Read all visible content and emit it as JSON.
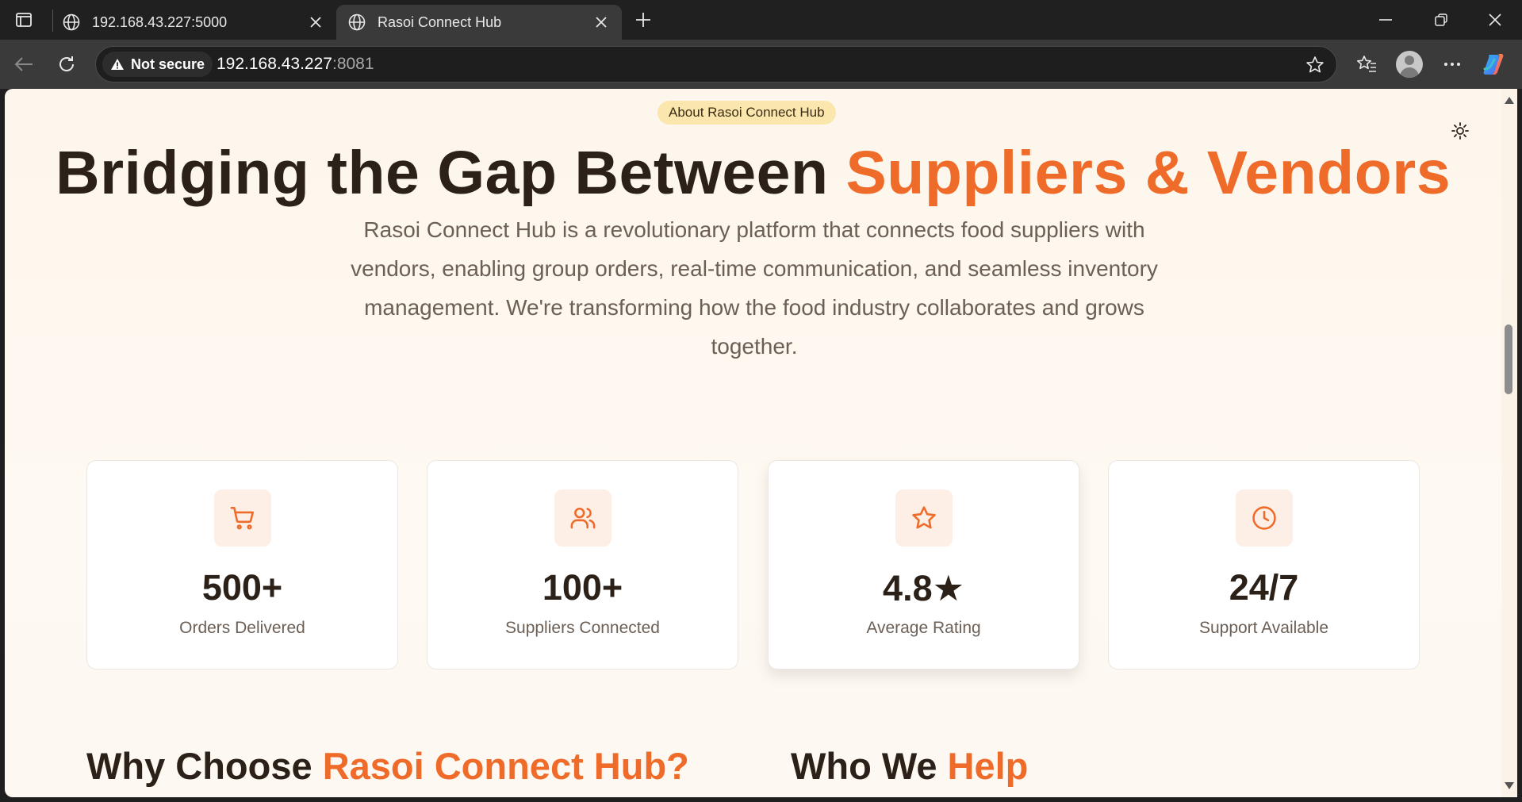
{
  "browser": {
    "tabs": [
      {
        "title": "192.168.43.227:5000",
        "active": false
      },
      {
        "title": "Rasoi Connect Hub",
        "active": true
      }
    ],
    "security_label": "Not secure",
    "url_host": "192.168.43.227",
    "url_port": ":8081",
    "icons": [
      "tab-actions-icon",
      "globe-icon",
      "close-icon",
      "new-tab-icon",
      "minimize-icon",
      "restore-icon",
      "back-icon",
      "reload-icon",
      "warning-icon",
      "star-icon",
      "favorites-icon",
      "profile-avatar",
      "more-icon",
      "copilot-icon"
    ]
  },
  "page": {
    "badge": "About Rasoi Connect Hub",
    "hero": {
      "title_plain": "Bridging the Gap Between ",
      "title_accent": "Suppliers & Vendors",
      "description": "Rasoi Connect Hub is a revolutionary platform that connects food suppliers with vendors, enabling group orders, real-time communication, and seamless inventory management. We're transforming how the food industry collaborates and grows together."
    },
    "stats": [
      {
        "value": "500+",
        "label": "Orders Delivered",
        "icon": "cart-icon"
      },
      {
        "value": "100+",
        "label": "Suppliers Connected",
        "icon": "users-icon"
      },
      {
        "value": "4.8★",
        "label": "Average Rating",
        "icon": "star-icon"
      },
      {
        "value": "24/7",
        "label": "Support Available",
        "icon": "clock-icon"
      }
    ],
    "sections": {
      "why_plain": "Why Choose ",
      "why_accent": "Rasoi Connect Hub?",
      "who_plain": "Who We ",
      "who_accent": "Help"
    }
  },
  "colors": {
    "accent": "#ef6b2a",
    "heading": "#2b2118",
    "badge_bg": "#fbe7ad",
    "icon_bg": "#fdeee6"
  }
}
